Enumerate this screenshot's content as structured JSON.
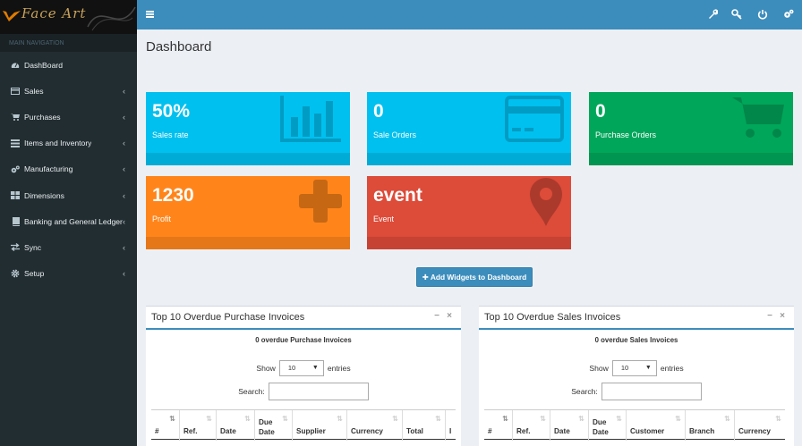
{
  "sidebar": {
    "header": "MAIN NAVIGATION",
    "logo_text": "Face Art",
    "items": [
      {
        "label": "DashBoard",
        "icon": "dashboard-icon",
        "chevron": ""
      },
      {
        "label": "Sales",
        "icon": "credit-card-icon",
        "chevron": "‹"
      },
      {
        "label": "Purchases",
        "icon": "cart-icon",
        "chevron": "‹"
      },
      {
        "label": "Items and Inventory",
        "icon": "list-icon",
        "chevron": "‹"
      },
      {
        "label": "Manufacturing",
        "icon": "gears-icon",
        "chevron": "‹"
      },
      {
        "label": "Dimensions",
        "icon": "grid-icon",
        "chevron": "‹"
      },
      {
        "label": "Banking and General Ledger",
        "icon": "book-icon",
        "chevron": "‹"
      },
      {
        "label": "Sync",
        "icon": "exchange-icon",
        "chevron": "‹"
      },
      {
        "label": "Setup",
        "icon": "gear-icon",
        "chevron": "‹"
      }
    ]
  },
  "topbar": {
    "icons": [
      "wrench-icon",
      "key-icon",
      "power-icon",
      "settings-icon"
    ]
  },
  "page": {
    "title": "Dashboard"
  },
  "boxes": [
    {
      "value": "50%",
      "label": "Sales rate",
      "color": "#00c0ef",
      "icon": "bar-chart-icon"
    },
    {
      "value": "0",
      "label": "Sale Orders",
      "color": "#00c0ef",
      "icon": "credit-card-icon"
    },
    {
      "value": "0",
      "label": "Purchase Orders",
      "color": "#00a65a",
      "icon": "cart-icon"
    },
    {
      "value": "1230",
      "label": "Profit",
      "color": "#ff851b",
      "icon": "plus-icon"
    },
    {
      "value": "event",
      "label": "Event",
      "color": "#dd4b39",
      "icon": "map-marker-icon"
    }
  ],
  "add_widgets": "Add Widgets to Dashboard",
  "panels": [
    {
      "title": "Top 10 Overdue Purchase Invoices",
      "subtitle": "0 overdue Purchase Invoices",
      "show": "Show",
      "entries": "entries",
      "page_size": "10",
      "search": "Search:",
      "columns": [
        "#",
        "Ref.",
        "Date",
        "Due Date",
        "Supplier",
        "Currency",
        "Total",
        "I"
      ]
    },
    {
      "title": "Top 10 Overdue Sales Invoices",
      "subtitle": "0 overdue Sales Invoices",
      "show": "Show",
      "entries": "entries",
      "page_size": "10",
      "search": "Search:",
      "columns": [
        "#",
        "Ref.",
        "Date",
        "Due Date",
        "Customer",
        "Branch",
        "Currency"
      ]
    }
  ]
}
